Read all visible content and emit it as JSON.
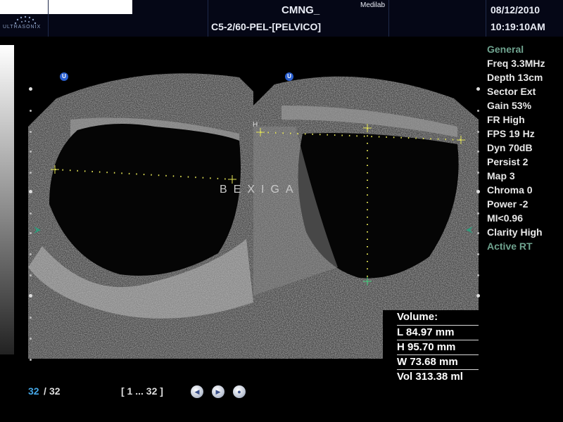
{
  "header": {
    "brand": "ULTRASONIX",
    "hospital": "CMNG_",
    "lab": "Medilab",
    "probe_preset": "C5-2/60-PEL-[PELVICO]",
    "date": "08/12/2010",
    "time": "10:19:10AM"
  },
  "settings": [
    {
      "label": "General",
      "color": "#6fa38f"
    },
    {
      "label": "Freq 3.3MHz"
    },
    {
      "label": "Depth 13cm"
    },
    {
      "label": "Sector Ext"
    },
    {
      "label": "Gain 53%"
    },
    {
      "label": "FR High"
    },
    {
      "label": "FPS 19 Hz"
    },
    {
      "label": "Dyn 70dB"
    },
    {
      "label": "Persist 2"
    },
    {
      "label": "Map 3"
    },
    {
      "label": "Chroma 0"
    },
    {
      "label": "Power -2"
    },
    {
      "label": "MI<0.96"
    },
    {
      "label": "Clarity High"
    },
    {
      "label": "Active RT",
      "color": "#6fa38f"
    }
  ],
  "image": {
    "annotation": "BEXIGA",
    "orientation_marker": "U",
    "left_label": "H"
  },
  "measurements": {
    "title": "Volume:",
    "rows": [
      "L 84.97 mm",
      "H 95.70 mm",
      "W 73.68 mm",
      "Vol 313.38 ml"
    ]
  },
  "cine": {
    "current": "32",
    "separator": "/",
    "total": "32",
    "range": "[ 1 ... 32 ]",
    "controls": [
      "rewind-icon",
      "play-icon",
      "stop-icon"
    ]
  }
}
